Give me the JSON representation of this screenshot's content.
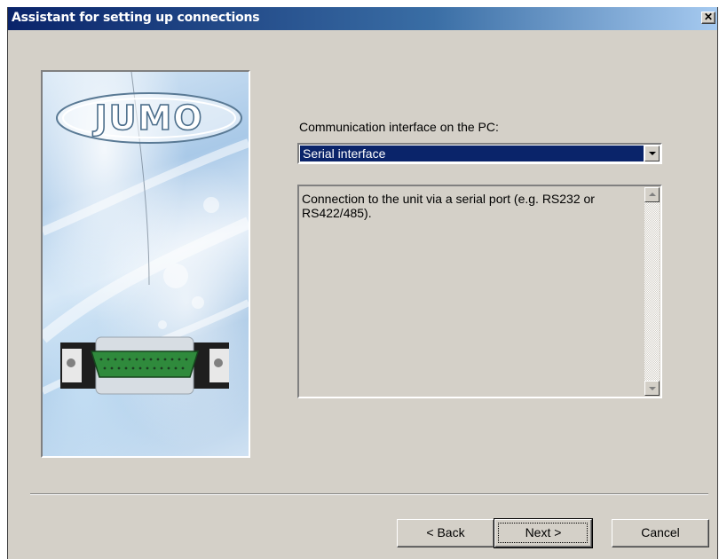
{
  "window": {
    "title": "Assistant for setting up connections",
    "close_glyph": "✕",
    "titlebar_colors": [
      "#0a246a",
      "#a6caf0"
    ]
  },
  "wizard_image": {
    "logo_text": "JUMO",
    "icon": "serial-connector-icon",
    "connector_color": "#2f8a3c"
  },
  "interface": {
    "label": "Communication interface on the PC:",
    "selected": "Serial interface"
  },
  "description": {
    "text": "Connection to the unit via a serial port (e.g. RS232 or RS422/485)."
  },
  "buttons": {
    "back": "< Back",
    "next": "Next >",
    "cancel": "Cancel"
  }
}
